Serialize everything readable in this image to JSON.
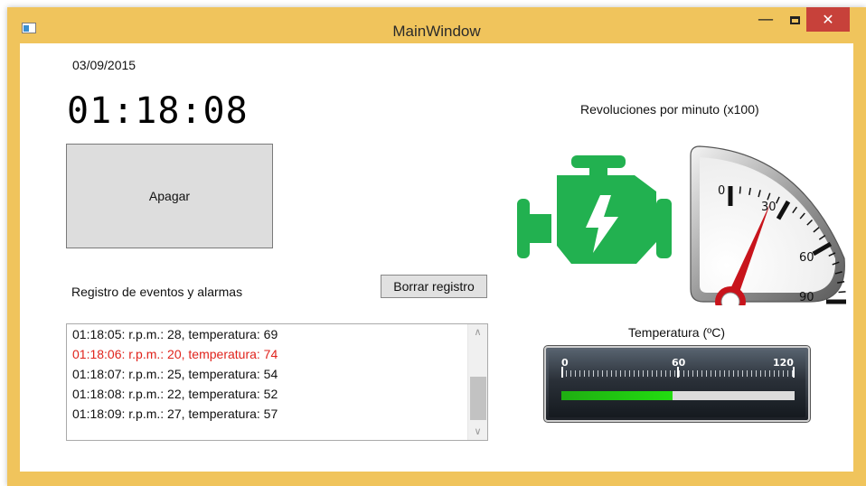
{
  "window": {
    "title": "MainWindow",
    "min_glyph": "—",
    "close_glyph": "✕"
  },
  "main": {
    "date": "03/09/2015",
    "clock": "01:18:08",
    "off_button_label": "Apagar",
    "log_label": "Registro de eventos y alarmas",
    "clear_button_label": "Borrar registro",
    "log_entries": [
      {
        "text": "01:18:05: r.p.m.: 28, temperatura: 69",
        "alarm": false
      },
      {
        "text": "01:18:06: r.p.m.: 20, temperatura: 74",
        "alarm": true
      },
      {
        "text": "01:18:07: r.p.m.: 25, temperatura: 54",
        "alarm": false
      },
      {
        "text": "01:18:08: r.p.m.: 22, temperatura: 52",
        "alarm": false
      },
      {
        "text": "01:18:09: r.p.m.: 27, temperatura: 57",
        "alarm": false
      }
    ],
    "scroll_up_glyph": "∧",
    "scroll_down_glyph": "∨"
  },
  "rpm": {
    "title": "Revoluciones por minuto (x100)",
    "tick_labels": [
      "0",
      "30",
      "60",
      "90"
    ],
    "value": 22,
    "needle_color": "#c8141c",
    "engine_icon_color": "#22b150"
  },
  "temperature": {
    "title": "Temperatura (ºC)",
    "tick_labels": [
      "0",
      "60",
      "120"
    ],
    "min": 0,
    "max": 120,
    "value": 57,
    "fill_color": "#22cc10"
  }
}
